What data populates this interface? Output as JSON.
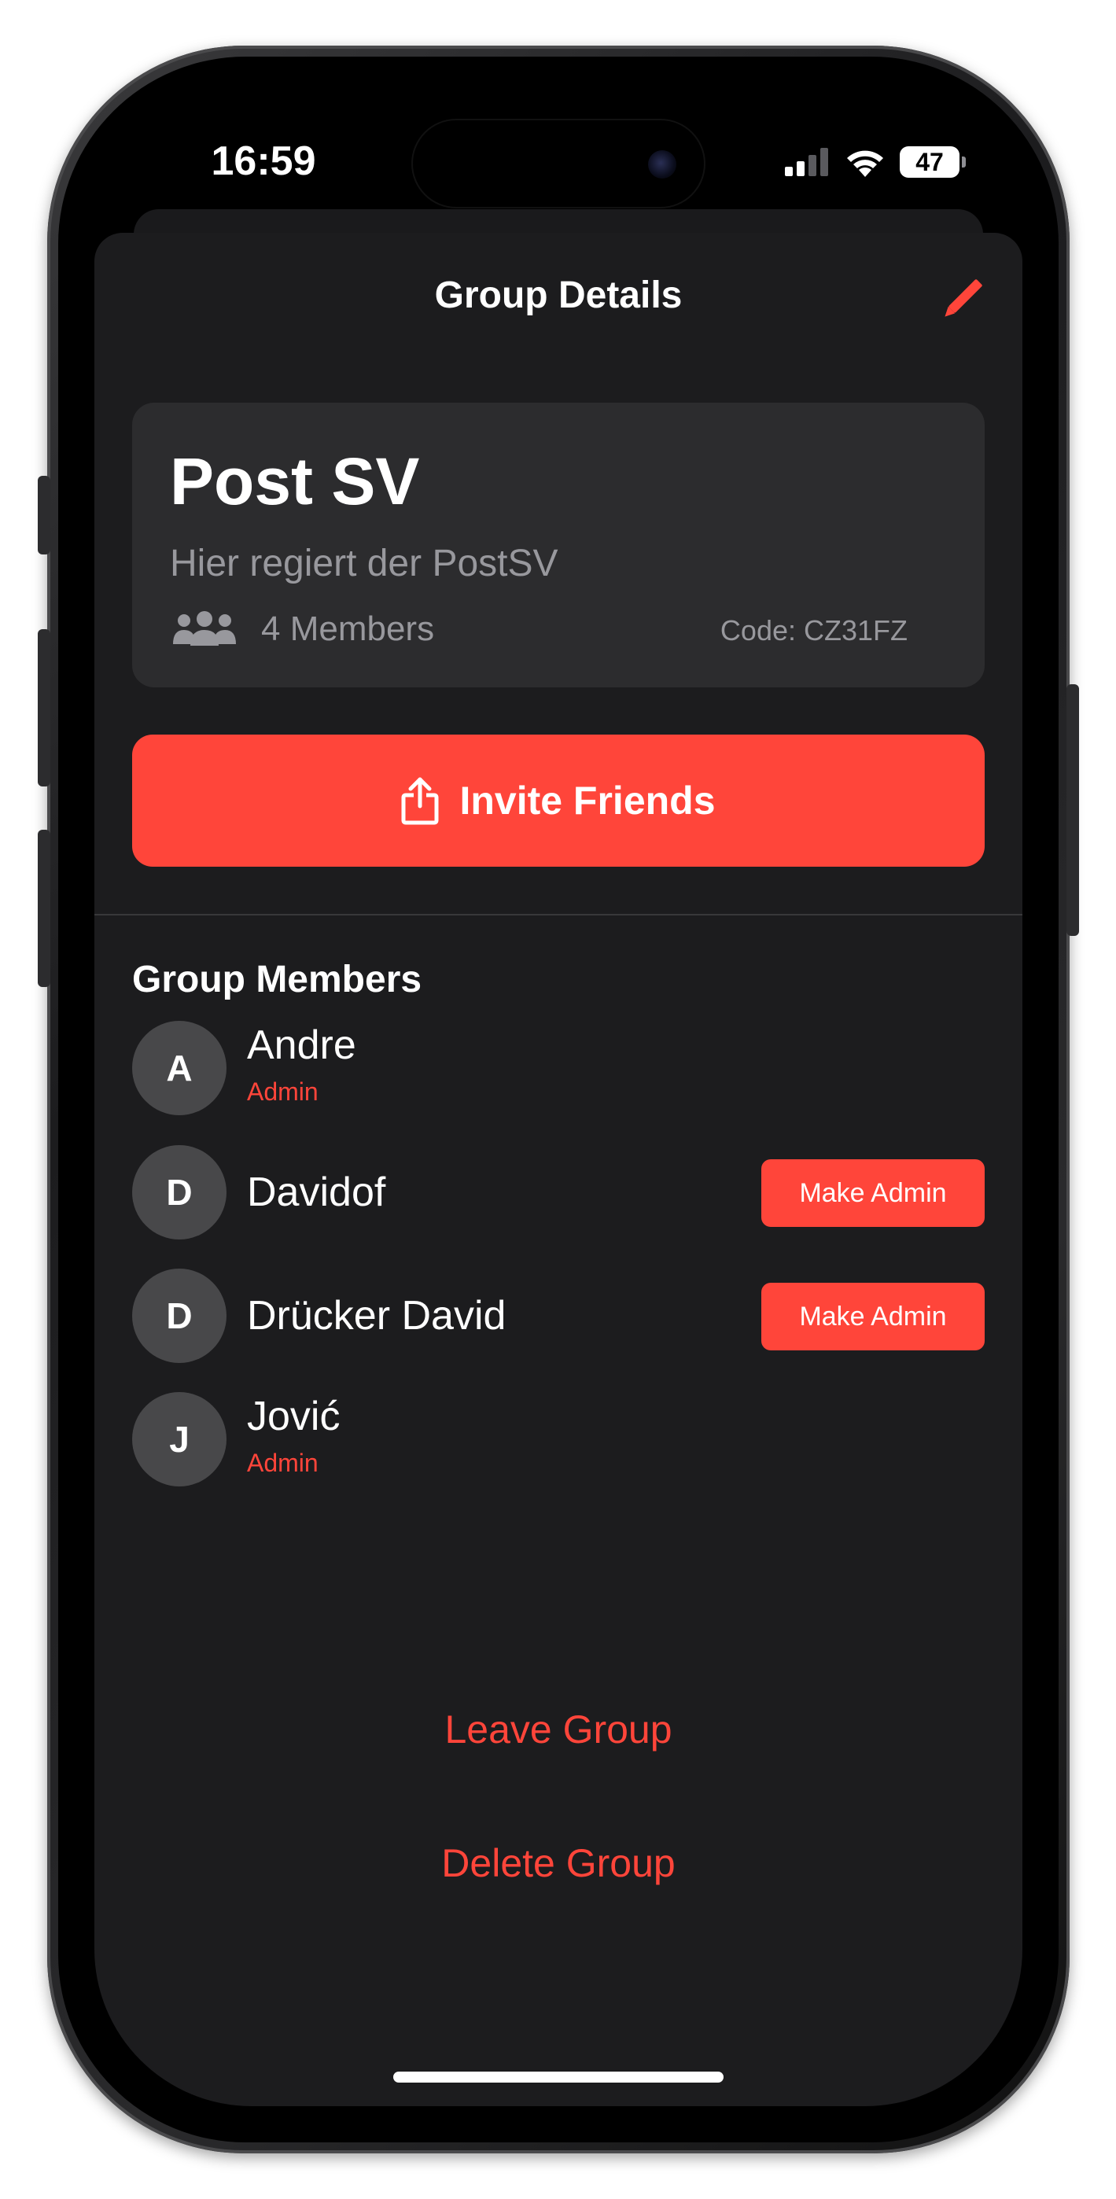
{
  "status_bar": {
    "time": "16:59",
    "battery": "47",
    "icons": [
      "cellular-signal-icon",
      "wifi-icon",
      "battery-icon"
    ]
  },
  "header": {
    "title": "Group Details",
    "edit_icon": "pencil-icon"
  },
  "group": {
    "name": "Post SV",
    "description": "Hier regiert der PostSV",
    "members_icon": "people-icon",
    "members_count": "4 Members",
    "code": "Code: CZ31FZ"
  },
  "invite": {
    "label": "Invite Friends",
    "icon": "share-icon"
  },
  "members_section": {
    "heading": "Group Members",
    "members": [
      {
        "initial": "A",
        "name": "Andre",
        "role": "Admin",
        "action": ""
      },
      {
        "initial": "D",
        "name": "Davidof",
        "role": "",
        "action": "Make Admin"
      },
      {
        "initial": "D",
        "name": "Drücker David",
        "role": "",
        "action": "Make Admin"
      },
      {
        "initial": "J",
        "name": "Jović",
        "role": "Admin",
        "action": ""
      }
    ]
  },
  "actions": {
    "leave": "Leave Group",
    "delete": "Delete Group"
  },
  "colors": {
    "accent": "#ff453a",
    "background": "#1c1c1e",
    "card": "#2c2c2e",
    "avatar": "#48484a",
    "secondary_text": "#98989d"
  }
}
